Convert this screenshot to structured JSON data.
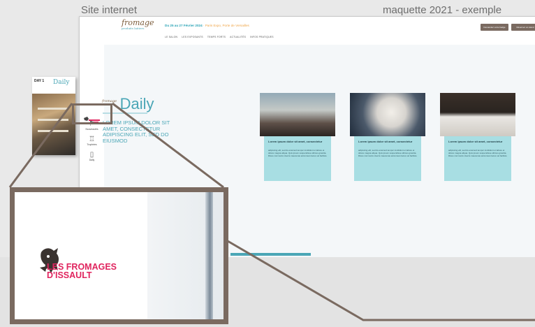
{
  "captions": {
    "left": "Site internet",
    "right": "maquette 2021 - exemple"
  },
  "site": {
    "logo_main": "fromage",
    "logo_sub": "produits laitiers",
    "event_date": "Du 25 au 27 Février 2024",
    "event_place": " · Paris Expo, Porte de Versailles",
    "nav": [
      "LE SALON",
      "LES EXPOSANTS",
      "TEMPS FORTS",
      "ACTUALITÉS",
      "INFOS PRATIQUES"
    ],
    "header_buttons": [
      "Demandez votre badge",
      "Réservez un stand"
    ],
    "sidebar": [
      {
        "label": "Nouveautés",
        "icon": "trophy-icon"
      },
      {
        "label": "Trophées",
        "icon": "cup-icon"
      },
      {
        "label": "Daily",
        "icon": "newspaper-icon"
      }
    ],
    "magazine": {
      "day": "DAY 1",
      "title": "Daily"
    },
    "daily": {
      "prefix": "fromage",
      "title": "Daily"
    },
    "lorem": "LOREM IPSUM DOLOR SIT AMET, CONSECTETUR ADIPISCING ELIT, SED DO EIUSMOD",
    "cards": [
      {
        "title": "Lorem ipsum dolor sit amet, consectetur",
        "text": "adipiscing elit, sed do eiusmod tempor incididunt ut labore et dolore magna aliqua. Quis ipsum suspendisse ultrices gravida. Risus commodo viverra maecenas accumsan lacus vel facilisis."
      },
      {
        "title": "Lorem ipsum dolor sit amet, consectetur",
        "text": "adipiscing elit, sed do eiusmod tempor incididunt ut labore et dolore magna aliqua. Quis ipsum suspendisse ultrices gravida. Risus commodo viverra maecenas accumsan lacus vel facilisis."
      },
      {
        "title": "Lorem ipsum dolor sit amet, consectetur",
        "text": "adipiscing elit, sed do eiusmod tempor incididunt ut labore et dolore magna aliqua. Quis ipsum suspendisse ultrices gravida. Risus commodo viverra maecenas accumsan lacus vel facilisis."
      }
    ]
  },
  "zoom": {
    "logo_line1": "LES FROMAGES",
    "logo_line2": "D'ISSAULT"
  },
  "colors": {
    "accent": "#4aa6b6",
    "brand_pink": "#e0245e",
    "frame": "#7a6a60"
  }
}
